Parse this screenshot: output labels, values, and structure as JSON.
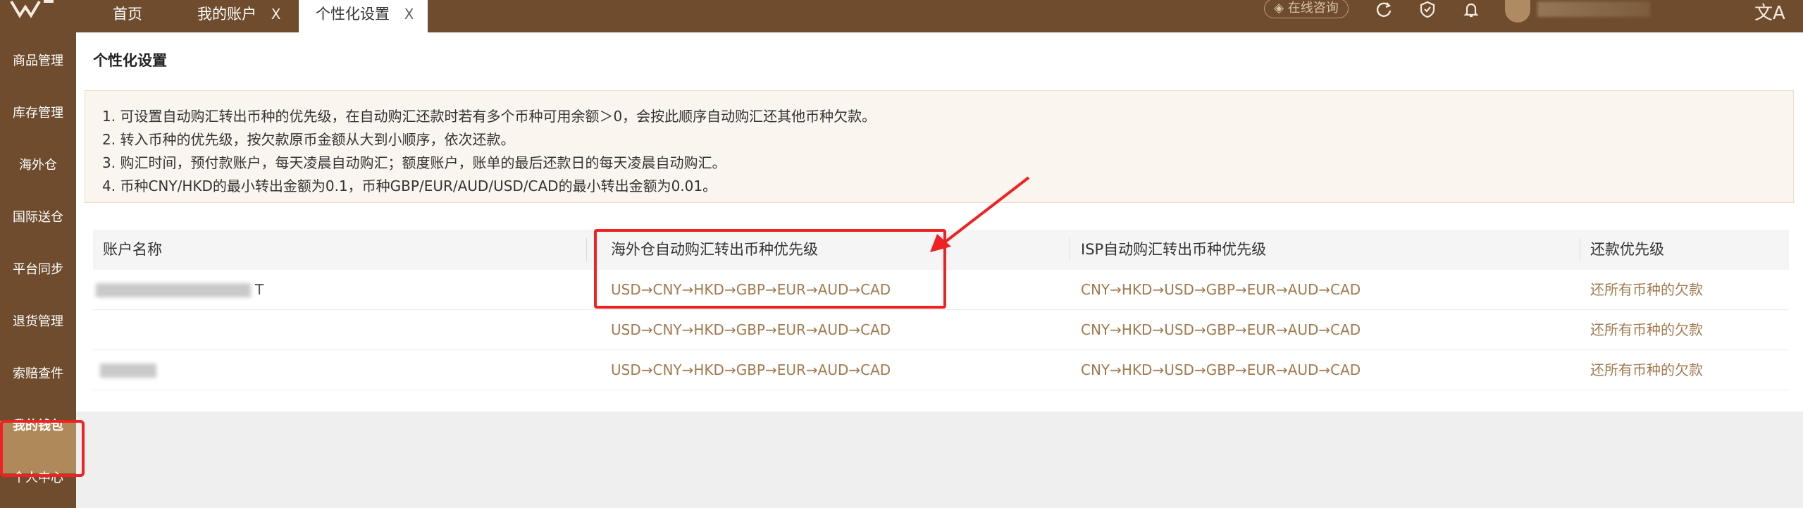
{
  "topbar": {
    "tabs": [
      {
        "label": "首页",
        "closable": false,
        "active": false
      },
      {
        "label": "我的账户",
        "closable": true,
        "active": false
      },
      {
        "label": "个性化设置",
        "closable": true,
        "active": true
      }
    ],
    "close_glyph": "X",
    "online_consult": "在线咨询",
    "icons": [
      "refresh-icon",
      "badge-icon",
      "bell-icon",
      "avatar",
      "translate-icon"
    ]
  },
  "sidebar": {
    "items": [
      {
        "label": "商品管理"
      },
      {
        "label": "库存管理"
      },
      {
        "label": "海外仓"
      },
      {
        "label": "国际送仓"
      },
      {
        "label": "平台同步"
      },
      {
        "label": "退货管理"
      },
      {
        "label": "索赔查件"
      },
      {
        "label": "我的钱包",
        "active": true
      },
      {
        "label": "个人中心"
      }
    ]
  },
  "page": {
    "title": "个性化设置",
    "notices": [
      "1. 可设置自动购汇转出币种的优先级，在自动购汇还款时若有多个币种可用余额＞0，会按此顺序自动购汇还其他币种欠款。",
      "2. 转入币种的优先级，按欠款原币金额从大到小顺序，依次还款。",
      "3. 购汇时间，预付款账户，每天凌晨自动购汇；额度账户，账单的最后还款日的每天凌晨自动购汇。",
      "4. 币种CNY/HKD的最小转出金额为0.1，币种GBP/EUR/AUD/USD/CAD的最小转出金额为0.01。"
    ]
  },
  "table": {
    "headers": {
      "account": "账户名称",
      "overseas": "海外仓自动购汇转出币种优先级",
      "isp": "ISP自动购汇转出币种优先级",
      "repay": "还款优先级"
    },
    "rows": [
      {
        "account_suffix": "T",
        "overseas": "USD→CNY→HKD→GBP→EUR→AUD→CAD",
        "isp": "CNY→HKD→USD→GBP→EUR→AUD→CAD",
        "repay": "还所有币种的欠款"
      },
      {
        "account_suffix": "",
        "overseas": "USD→CNY→HKD→GBP→EUR→AUD→CAD",
        "isp": "CNY→HKD→USD→GBP→EUR→AUD→CAD",
        "repay": "还所有币种的欠款"
      },
      {
        "account_suffix": "",
        "overseas": "USD→CNY→HKD→GBP→EUR→AUD→CAD",
        "isp": "CNY→HKD→USD→GBP→EUR→AUD→CAD",
        "repay": "还所有币种的欠款"
      }
    ]
  },
  "colors": {
    "brand": "#6e4c2d",
    "active_sidebar": "#b0895b",
    "link_text": "#a27a4f",
    "highlight": "#ee2222"
  }
}
